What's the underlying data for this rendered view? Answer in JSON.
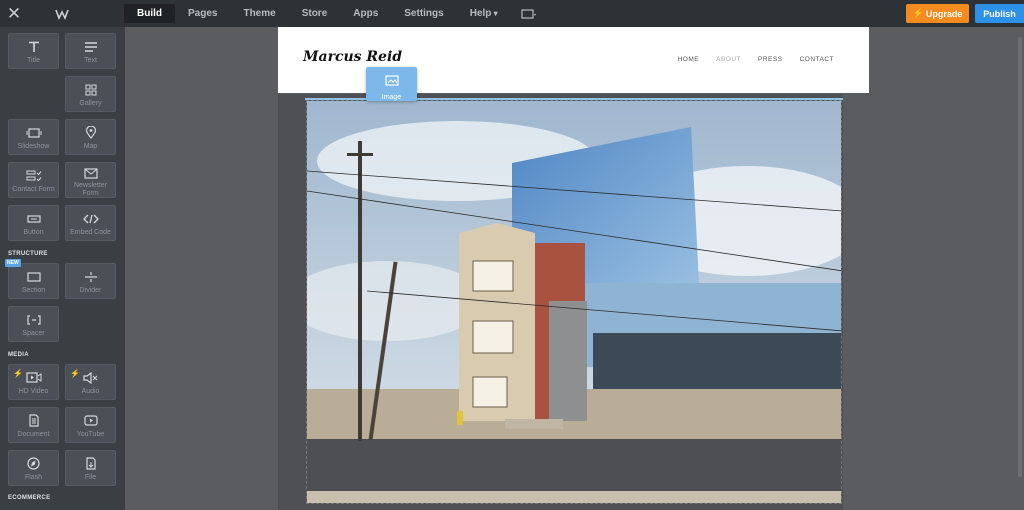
{
  "topbar": {
    "close_glyph": "✕",
    "nav": [
      "Build",
      "Pages",
      "Theme",
      "Store",
      "Apps",
      "Settings",
      "Help"
    ],
    "active": "Build",
    "upgrade_label": "Upgrade",
    "publish_label": "Publish"
  },
  "sidebar": {
    "elements": [
      {
        "label": "Title",
        "icon": "title-icon"
      },
      {
        "label": "Text",
        "icon": "text-icon"
      },
      {
        "label": "Gallery",
        "icon": "gallery-icon"
      },
      {
        "label": "Slideshow",
        "icon": "slideshow-icon"
      },
      {
        "label": "Map",
        "icon": "map-pin-icon"
      },
      {
        "label": "Contact Form",
        "icon": "contact-form-icon"
      },
      {
        "label": "Newsletter Form",
        "icon": "envelope-icon"
      },
      {
        "label": "Button",
        "icon": "button-icon"
      },
      {
        "label": "Embed Code",
        "icon": "code-icon"
      }
    ],
    "structure_heading": "STRUCTURE",
    "new_badge": "NEW",
    "structure": [
      {
        "label": "Section",
        "icon": "section-icon"
      },
      {
        "label": "Divider",
        "icon": "divider-icon"
      },
      {
        "label": "Spacer",
        "icon": "spacer-icon"
      }
    ],
    "media_heading": "MEDIA",
    "media": [
      {
        "label": "HD Video",
        "icon": "video-icon"
      },
      {
        "label": "Audio",
        "icon": "audio-icon"
      },
      {
        "label": "Document",
        "icon": "document-icon"
      },
      {
        "label": "YouTube",
        "icon": "youtube-icon"
      },
      {
        "label": "Flash",
        "icon": "flash-icon"
      },
      {
        "label": "File",
        "icon": "file-icon"
      }
    ],
    "ecommerce_heading": "ECOMMERCE"
  },
  "site": {
    "title": "Marcus Reid",
    "nav": [
      "HOME",
      "ABOUT",
      "PRESS",
      "CONTACT"
    ]
  },
  "drag": {
    "label": "Image",
    "icon": "image-icon"
  },
  "colors": {
    "topbar": "#2d3236",
    "sidebar": "#3a3f44",
    "upgrade": "#f58a1f",
    "publish": "#2e91e8",
    "drag_tile": "#7db8ea"
  }
}
